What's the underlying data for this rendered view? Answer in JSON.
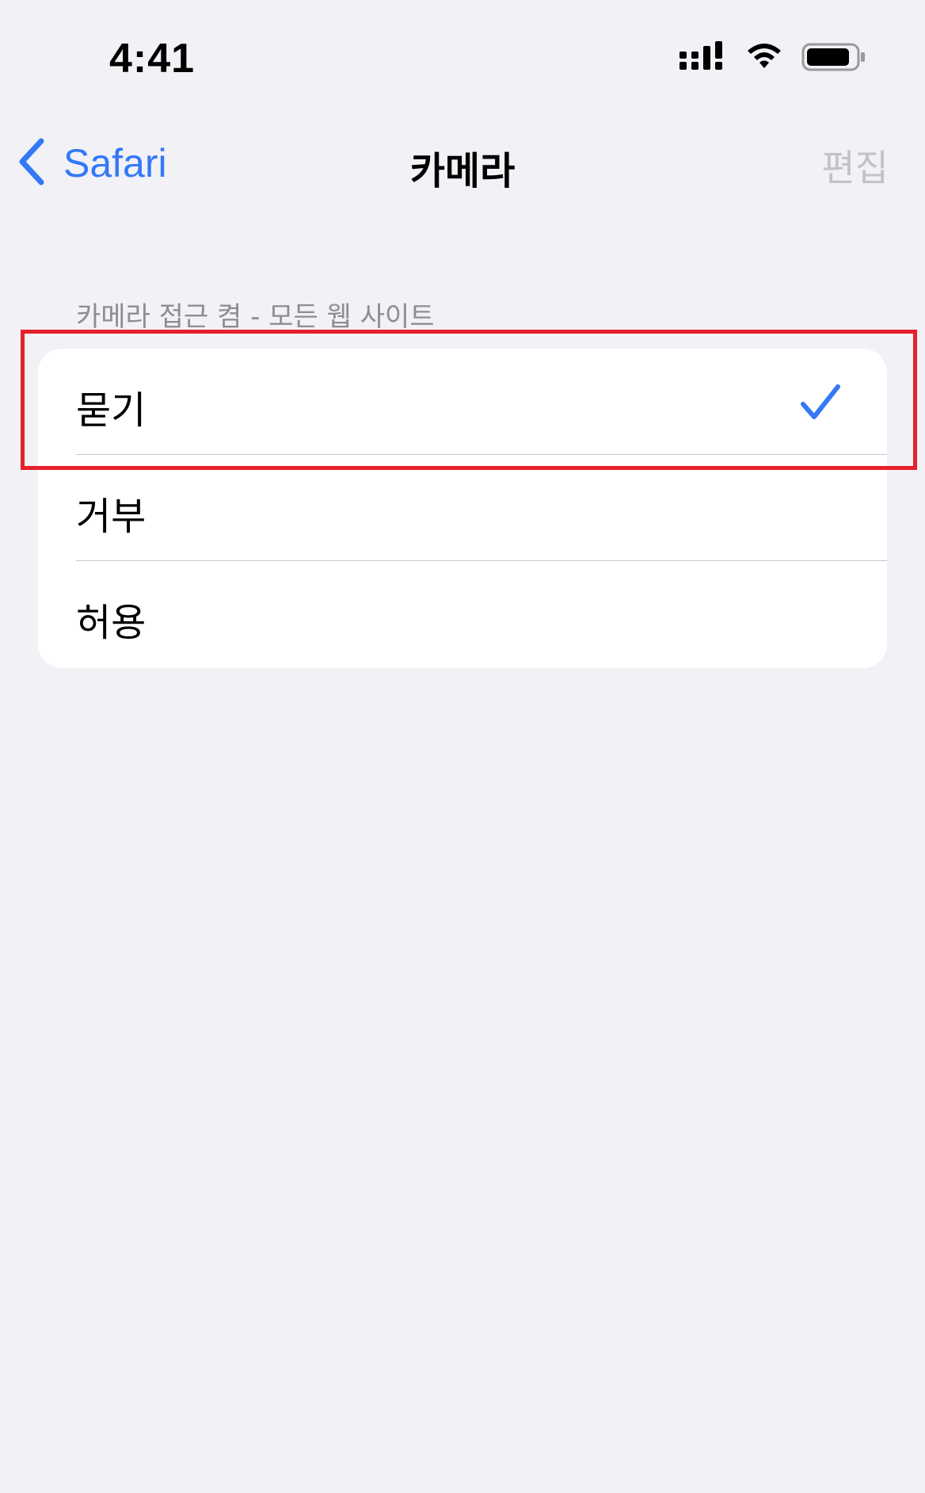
{
  "status_bar": {
    "time": "4:41",
    "icons": [
      "cellular-signal-icon",
      "wifi-icon",
      "battery-icon"
    ]
  },
  "nav": {
    "back_label": "Safari",
    "back_icon": "chevron-left-icon",
    "title": "카메라",
    "edit_label": "편집"
  },
  "section": {
    "header": "카메라 접근 켬 - 모든 웹 사이트",
    "options": [
      {
        "label": "묻기",
        "selected": true
      },
      {
        "label": "거부",
        "selected": false
      },
      {
        "label": "허용",
        "selected": false
      }
    ]
  },
  "colors": {
    "accent": "#3478f6",
    "background": "#f1f1f6",
    "highlight": "#e5202a",
    "disabled_text": "#c2c2c7",
    "secondary_text": "#8d8d92"
  }
}
